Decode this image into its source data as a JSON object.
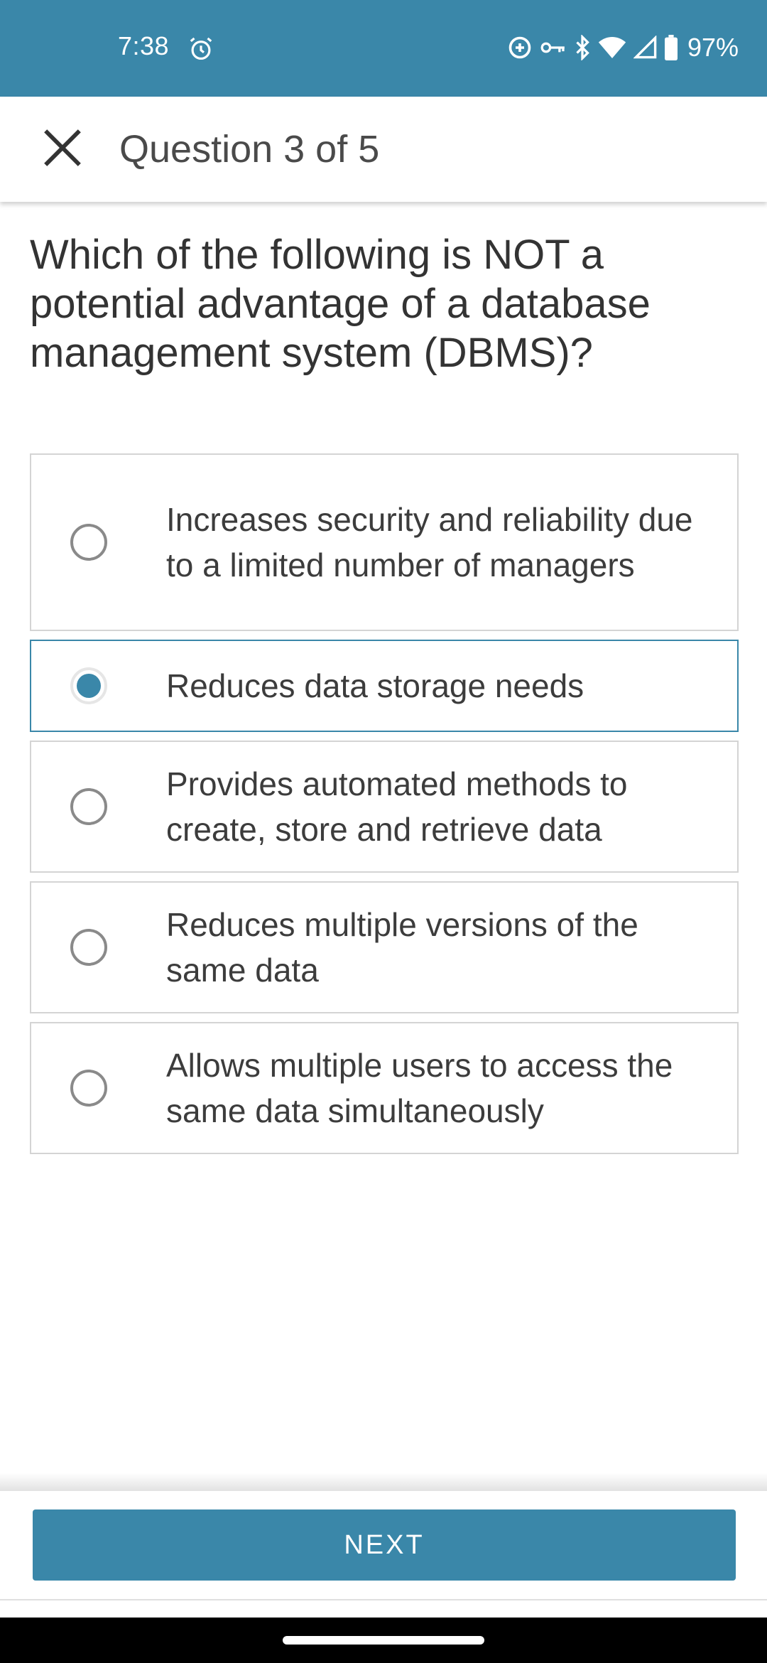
{
  "status_bar": {
    "time": "7:38",
    "battery": "97%",
    "icons": [
      "alarm-icon",
      "data-saver-icon",
      "vpn-key-icon",
      "bluetooth-icon",
      "wifi-icon",
      "cell-signal-icon",
      "battery-icon"
    ],
    "background": "#3a87a9"
  },
  "app_bar": {
    "close_icon": "close-icon",
    "title": "Question 3 of 5"
  },
  "question": {
    "text": "Which of the following is NOT a potential advantage of a database management system (DBMS)?"
  },
  "options": [
    {
      "label": "Increases security and reliability due to a limited number of managers",
      "selected": false
    },
    {
      "label": "Reduces data storage needs",
      "selected": true
    },
    {
      "label": "Provides automated methods to create, store and retrieve data",
      "selected": false
    },
    {
      "label": "Reduces multiple versions of the same data",
      "selected": false
    },
    {
      "label": "Allows multiple users to access the same data simultaneously",
      "selected": false
    }
  ],
  "footer": {
    "next_label": "NEXT"
  },
  "colors": {
    "accent": "#3a87a9",
    "text": "#333333",
    "border": "#d4d4d4"
  }
}
